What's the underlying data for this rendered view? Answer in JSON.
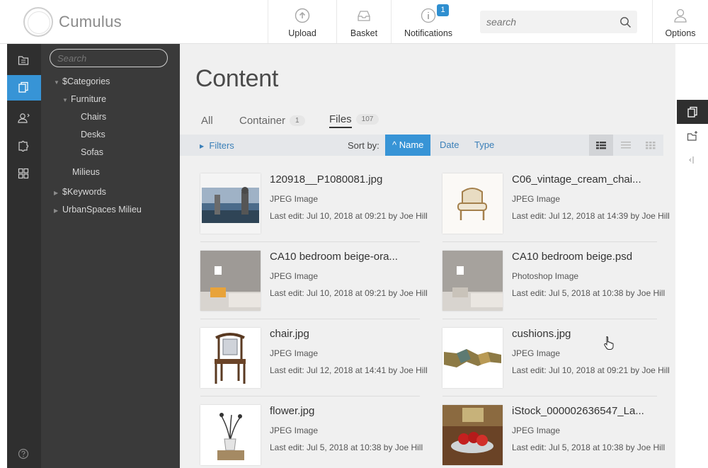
{
  "header": {
    "brand": "Cumulus",
    "buttons": [
      {
        "label": "Upload",
        "icon": "upload-icon"
      },
      {
        "label": "Basket",
        "icon": "basket-icon"
      },
      {
        "label": "Notifications",
        "icon": "info-icon"
      },
      {
        "label": "Options",
        "icon": "user-icon"
      }
    ],
    "notification_count": "1",
    "search_placeholder": "search"
  },
  "rail": {
    "items": [
      "folder-icon",
      "documents-icon",
      "user-settings-icon",
      "puzzle-icon",
      "grid-icon",
      "help-icon"
    ],
    "active_index": 1,
    "active_color": "#3794d6"
  },
  "tree": {
    "search_placeholder": "Search",
    "nodes": [
      {
        "label": "$Categories",
        "level": 0,
        "arrow": "down"
      },
      {
        "label": "Furniture",
        "level": 1,
        "arrow": "down"
      },
      {
        "label": "Chairs",
        "level": 2,
        "arrow": ""
      },
      {
        "label": "Desks",
        "level": 2,
        "arrow": ""
      },
      {
        "label": "Sofas",
        "level": 2,
        "arrow": ""
      },
      {
        "label": "Milieus",
        "level": 1,
        "arrow": ""
      },
      {
        "label": "$Keywords",
        "level": 0,
        "arrow": "right"
      },
      {
        "label": "UrbanSpaces Milieu",
        "level": 0,
        "arrow": "right"
      }
    ]
  },
  "main": {
    "title": "Content",
    "tabs": [
      {
        "label": "All",
        "count": ""
      },
      {
        "label": "Container",
        "count": "1"
      },
      {
        "label": "Files",
        "count": "107",
        "active": true
      }
    ],
    "toolbar": {
      "filters": "Filters",
      "sort_label": "Sort by:",
      "sort_options": [
        "^ Name",
        "Date",
        "Type"
      ],
      "active_sort": "Name"
    },
    "files": [
      {
        "name": "120918__P1080081.jpg",
        "type": "JPEG Image",
        "edit": "Last edit: Jul 10, 2018 at 09:21 by Joe Hill",
        "thumb": "balcony"
      },
      {
        "name": "C06_vintage_cream_chai...",
        "type": "JPEG Image",
        "edit": "Last edit: Jul 12, 2018 at 14:39 by Joe Hill",
        "thumb": "armchair"
      },
      {
        "name": "CA10 bedroom beige-ora...",
        "type": "JPEG Image",
        "edit": "Last edit: Jul 10, 2018 at 09:21 by Joe Hill",
        "thumb": "bedroom"
      },
      {
        "name": "CA10 bedroom beige.psd",
        "type": "Photoshop Image",
        "edit": "Last edit: Jul 5, 2018 at 10:38 by Joe Hill",
        "thumb": "bedroom"
      },
      {
        "name": "chair.jpg",
        "type": "JPEG Image",
        "edit": "Last edit: Jul 12, 2018 at 14:41 by Joe Hill",
        "thumb": "chair"
      },
      {
        "name": "cushions.jpg",
        "type": "JPEG Image",
        "edit": "Last edit: Jul 10, 2018 at 09:21 by Joe Hill",
        "thumb": "cushions"
      },
      {
        "name": "flower.jpg",
        "type": "JPEG Image",
        "edit": "Last edit: Jul 5, 2018 at 10:38 by Joe Hill",
        "thumb": "flower"
      },
      {
        "name": "iStock_000002636547_La...",
        "type": "JPEG Image",
        "edit": "Last edit: Jul 5, 2018 at 10:38 by Joe Hill",
        "thumb": "apples"
      }
    ]
  },
  "right_rail": [
    "documents-icon",
    "new-folder-icon",
    "collapse-icon"
  ]
}
